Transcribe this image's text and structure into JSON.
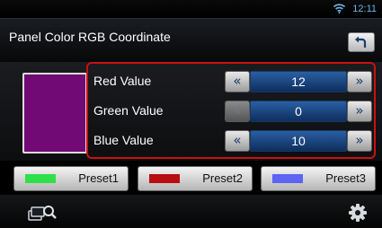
{
  "status": {
    "time": "12:11"
  },
  "header": {
    "title": "Panel Color RGB Coordinate"
  },
  "colors": {
    "swatch": "#710a74",
    "highlight": "#c81212",
    "field": "#1f4c8a"
  },
  "rows": [
    {
      "label": "Red Value",
      "value": "12",
      "dec_icon": "«",
      "inc_icon": "»"
    },
    {
      "label": "Green Value",
      "value": "0",
      "dec_icon": "«",
      "inc_icon": "»"
    },
    {
      "label": "Blue Value",
      "value": "10",
      "dec_icon": "«",
      "inc_icon": "»"
    }
  ],
  "presets": [
    {
      "label": "Preset1",
      "color": "#2ee14a"
    },
    {
      "label": "Preset2",
      "color": "#b80d12"
    },
    {
      "label": "Preset3",
      "color": "#5d63f2"
    }
  ]
}
